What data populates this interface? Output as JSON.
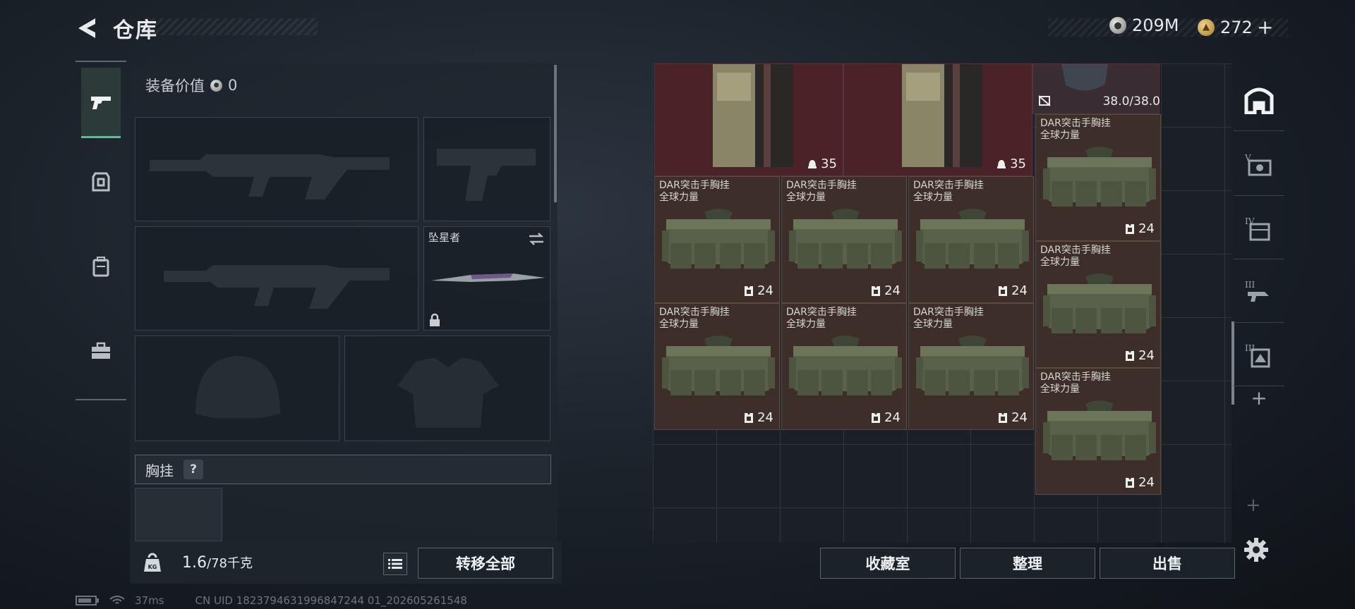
{
  "header": {
    "title": "仓库"
  },
  "currency": {
    "silver": "209M",
    "gold": "272",
    "gold_plus": "+"
  },
  "equipment": {
    "value_label": "装备价值",
    "value": "0",
    "melee_name": "坠星者",
    "section_label": "胸挂",
    "help_label": "?"
  },
  "footer_left": {
    "weight": "1.6",
    "capacity": "/78千克",
    "transfer_all": "转移全部"
  },
  "footer_right": {
    "collection": "收藏室",
    "sort": "整理",
    "sell": "出售"
  },
  "status": {
    "ping": "37ms",
    "uid": "CN UID 1823794631996847244 01_202605261548"
  },
  "durability": "38.0/38.0",
  "items": [
    {
      "name": "DAR突击手胸挂",
      "sub": "全球力量",
      "count": "24"
    },
    {
      "name": "DAR突击手胸挂",
      "sub": "全球力量",
      "count": "24"
    },
    {
      "name": "DAR突击手胸挂",
      "sub": "全球力量",
      "count": "24"
    },
    {
      "name": "DAR突击手胸挂",
      "sub": "全球力量",
      "count": "24"
    },
    {
      "name": "DAR突击手胸挂",
      "sub": "全球力量",
      "count": "24"
    },
    {
      "name": "DAR突击手胸挂",
      "sub": "全球力量",
      "count": "24"
    },
    {
      "name": "DAR突击手胸挂",
      "sub": "全球力量",
      "count": "24"
    },
    {
      "name": "DAR突击手胸挂",
      "sub": "全球力量",
      "count": "24"
    },
    {
      "name": "DAR突击手胸挂",
      "sub": "全球力量",
      "count": "24"
    }
  ],
  "top_items": [
    {
      "count": "35"
    },
    {
      "count": "35"
    }
  ],
  "icons": {
    "back": "chevron-left-icon",
    "weapons": "pistol-icon",
    "armor": "armor-icon",
    "backpack": "backpack-icon",
    "toolbox": "toolbox-icon",
    "settings": "gear-icon"
  },
  "colors": {
    "accent": "#49c596",
    "red_cell": "#4a2227",
    "brown_cell": "#3d2e29"
  }
}
